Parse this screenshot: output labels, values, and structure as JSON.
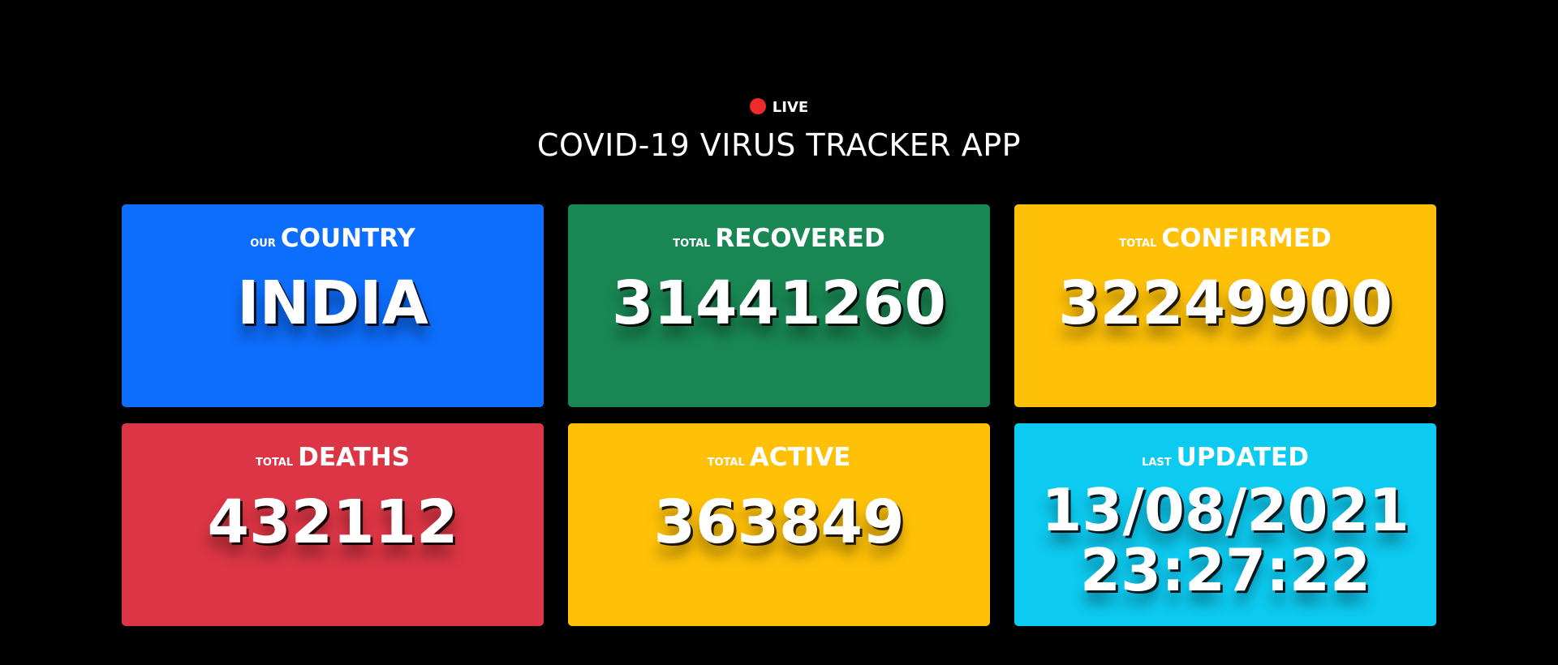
{
  "header": {
    "live_label": "LIVE",
    "title": "COVID-19 VIRUS TRACKER APP"
  },
  "colors": {
    "background": "#000000",
    "live_dot": "#ee2a2a",
    "blue": "#0d6efd",
    "green": "#198754",
    "yellow": "#ffc107",
    "red": "#dc3545",
    "cyan": "#0dcaf0"
  },
  "cards": [
    {
      "small": "OUR",
      "big": "COUNTRY",
      "value": "INDIA",
      "color": "#0d6efd"
    },
    {
      "small": "TOTAL",
      "big": "RECOVERED",
      "value": "31441260",
      "color": "#198754"
    },
    {
      "small": "TOTAL",
      "big": "CONFIRMED",
      "value": "32249900",
      "color": "#ffc107"
    },
    {
      "small": "TOTAL",
      "big": "DEATHS",
      "value": "432112",
      "color": "#dc3545"
    },
    {
      "small": "TOTAL",
      "big": "ACTIVE",
      "value": "363849",
      "color": "#ffc107"
    },
    {
      "small": "LAST",
      "big": "UPDATED",
      "value_date": "13/08/2021",
      "value_time": "23:27:22",
      "color": "#0dcaf0"
    }
  ]
}
